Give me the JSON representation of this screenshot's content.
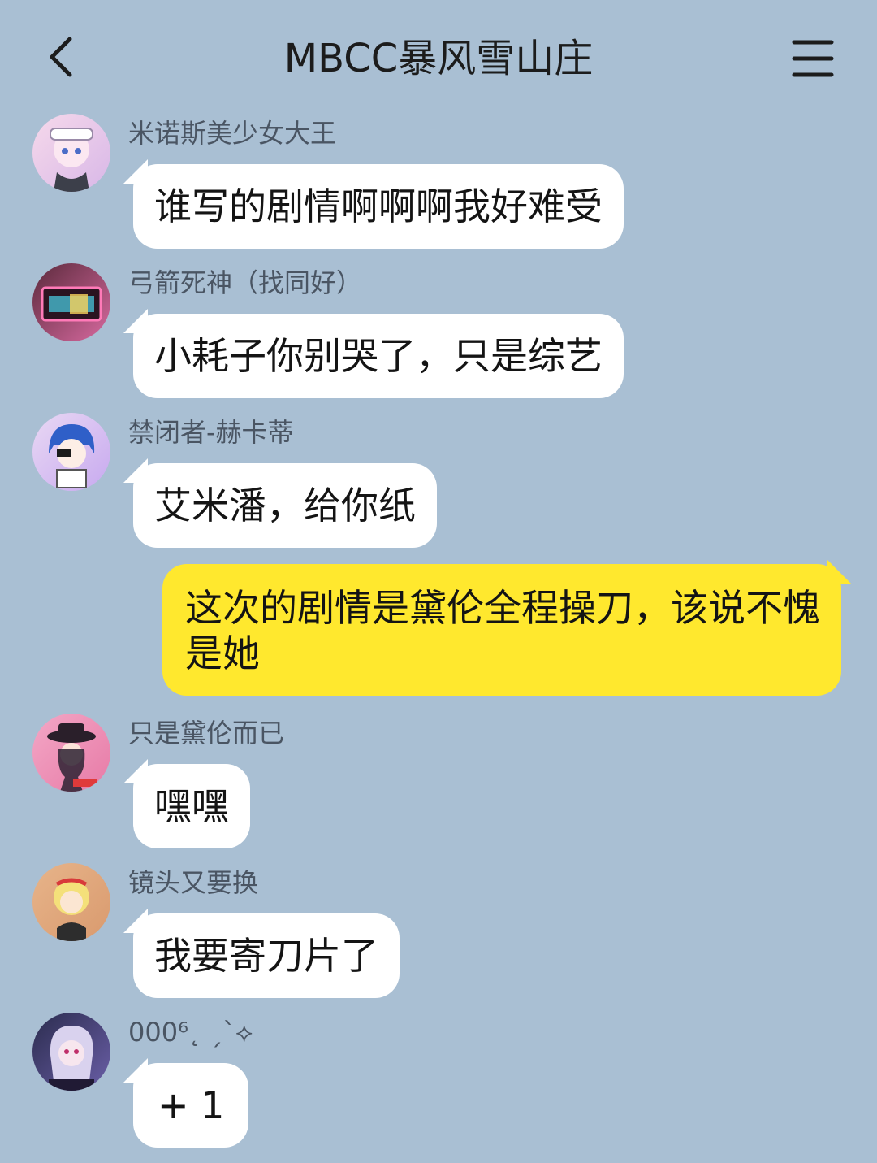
{
  "header": {
    "back_icon": "chevron-left-icon",
    "title": "MBCC暴风雪山庄",
    "menu_icon": "hamburger-menu-icon"
  },
  "messages": [
    {
      "sender": "米诺斯美少女大王",
      "text": "谁写的剧情啊啊啊我好难受",
      "avatar_colors": [
        "#f6d9ea",
        "#d8b7e8"
      ]
    },
    {
      "sender": "弓箭死神（找同好）",
      "text": "小耗子你别哭了，只是综艺",
      "avatar_colors": [
        "#5b2a3c",
        "#d86aa0"
      ]
    },
    {
      "sender": "禁闭者-赫卡蒂",
      "text": "艾米潘，给你纸",
      "avatar_colors": [
        "#e9d8f4",
        "#3f6fd0"
      ]
    },
    {
      "sender": "",
      "text": "这次的剧情是黛伦全程操刀，该说不愧是她",
      "mine": true
    },
    {
      "sender": "只是黛伦而已",
      "text": "嘿嘿",
      "avatar_colors": [
        "#f3a7c6",
        "#3a2a3a"
      ]
    },
    {
      "sender": "镜头又要换",
      "text": "我要寄刀片了",
      "avatar_colors": [
        "#e7b48a",
        "#f4e07a"
      ]
    },
    {
      "sender": "000⁶˛ ˏˋ⟡",
      "text": "+ 1",
      "avatar_colors": [
        "#2b2c4e",
        "#c8b6e6"
      ]
    }
  ]
}
